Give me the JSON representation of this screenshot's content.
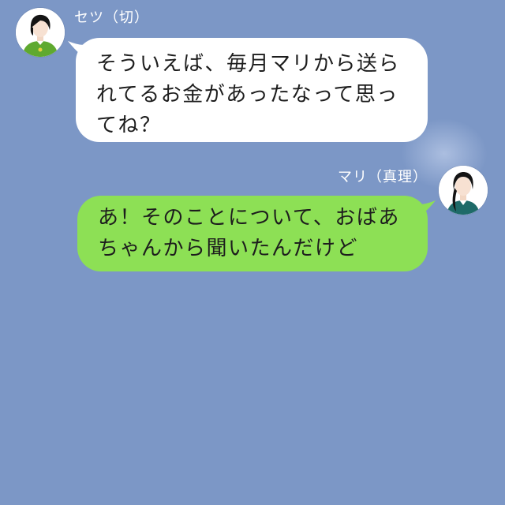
{
  "messages": [
    {
      "side": "left",
      "sender": "セツ（切）",
      "text": "そういえば、毎月マリから送られてるお金があったなって思ってね？",
      "bubble_color": "#ffffff",
      "avatar_icon": "woman-short-hair-icon"
    },
    {
      "side": "right",
      "sender": "マリ（真理）",
      "text": "あ！そのことについて、おばあちゃんから聞いたんだけど",
      "bubble_color": "#8de055",
      "avatar_icon": "woman-long-hair-icon"
    }
  ],
  "theme": {
    "background": "#7c97c6"
  }
}
